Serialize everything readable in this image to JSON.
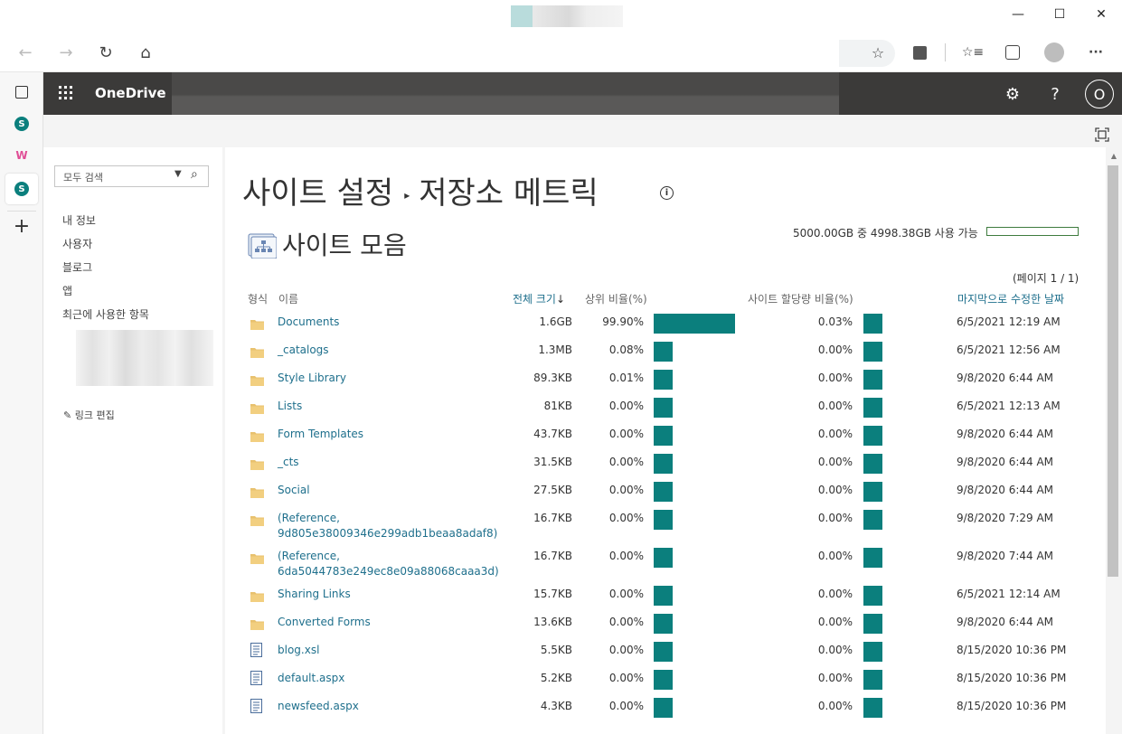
{
  "window": {
    "minimize": "—",
    "maximize": "☐",
    "close": "✕"
  },
  "toolbar": {
    "back": "←",
    "forward": "→",
    "refresh": "↻",
    "home": "⌂",
    "favorites": "☆",
    "menu": "···"
  },
  "suite": {
    "brand": "OneDrive",
    "avatar": "O"
  },
  "nav": {
    "search_placeholder": "모두 검색",
    "items": [
      "내 정보",
      "사용자",
      "블로그",
      "앱",
      "최근에 사용한 항목"
    ],
    "edit_links": "링크 편집"
  },
  "page": {
    "crumb1": "사이트 설정",
    "crumb2": "저장소 메트릭",
    "collection_title": "사이트 모음",
    "quota_text": "5000.00GB 중 4998.38GB 사용 가능",
    "page_info": "(페이지 1 / 1)"
  },
  "table": {
    "headers": {
      "type": "형식",
      "name": "이름",
      "total_size": "전체 크기",
      "parent_pct": "상위 비율(%)",
      "quota_pct": "사이트 할당량 비율(%)",
      "modified": "마지막으로 수정한 날짜"
    },
    "rows": [
      {
        "type": "folder",
        "name1": "Documents",
        "name2": "",
        "size": "1.6GB",
        "pct1": "99.90%",
        "fill1": 0.999,
        "pct2": "0.03%",
        "date": "6/5/2021 12:19 AM"
      },
      {
        "type": "folder",
        "name1": "_catalogs",
        "name2": "",
        "size": "1.3MB",
        "pct1": "0.08%",
        "fill1": 0,
        "pct2": "0.00%",
        "date": "6/5/2021 12:56 AM"
      },
      {
        "type": "folder",
        "name1": "Style Library",
        "name2": "",
        "size": "89.3KB",
        "pct1": "0.01%",
        "fill1": 0,
        "pct2": "0.00%",
        "date": "9/8/2020 6:44 AM"
      },
      {
        "type": "folder",
        "name1": "Lists",
        "name2": "",
        "size": "81KB",
        "pct1": "0.00%",
        "fill1": 0,
        "pct2": "0.00%",
        "date": "6/5/2021 12:13 AM"
      },
      {
        "type": "folder",
        "name1": "Form Templates",
        "name2": "",
        "size": "43.7KB",
        "pct1": "0.00%",
        "fill1": 0,
        "pct2": "0.00%",
        "date": "9/8/2020 6:44 AM"
      },
      {
        "type": "folder",
        "name1": "_cts",
        "name2": "",
        "size": "31.5KB",
        "pct1": "0.00%",
        "fill1": 0,
        "pct2": "0.00%",
        "date": "9/8/2020 6:44 AM"
      },
      {
        "type": "folder",
        "name1": "Social",
        "name2": "",
        "size": "27.5KB",
        "pct1": "0.00%",
        "fill1": 0,
        "pct2": "0.00%",
        "date": "9/8/2020 6:44 AM"
      },
      {
        "type": "folder",
        "name1": "(Reference,",
        "name2": "9d805e38009346e299adb1beaa8adaf8)",
        "size": "16.7KB",
        "pct1": "0.00%",
        "fill1": 0,
        "pct2": "0.00%",
        "date": "9/8/2020 7:29 AM"
      },
      {
        "type": "folder",
        "name1": "(Reference,",
        "name2": "6da5044783e249ec8e09a88068caaa3d)",
        "size": "16.7KB",
        "pct1": "0.00%",
        "fill1": 0,
        "pct2": "0.00%",
        "date": "9/8/2020 7:44 AM"
      },
      {
        "type": "folder",
        "name1": "Sharing Links",
        "name2": "",
        "size": "15.7KB",
        "pct1": "0.00%",
        "fill1": 0,
        "pct2": "0.00%",
        "date": "6/5/2021 12:14 AM"
      },
      {
        "type": "folder",
        "name1": "Converted Forms",
        "name2": "",
        "size": "13.6KB",
        "pct1": "0.00%",
        "fill1": 0,
        "pct2": "0.00%",
        "date": "9/8/2020 6:44 AM"
      },
      {
        "type": "file",
        "name1": "blog.xsl",
        "name2": "",
        "size": "5.5KB",
        "pct1": "0.00%",
        "fill1": 0,
        "pct2": "0.00%",
        "date": "8/15/2020 10:36 PM"
      },
      {
        "type": "file",
        "name1": "default.aspx",
        "name2": "",
        "size": "5.2KB",
        "pct1": "0.00%",
        "fill1": 0,
        "pct2": "0.00%",
        "date": "8/15/2020 10:36 PM"
      },
      {
        "type": "file",
        "name1": "newsfeed.aspx",
        "name2": "",
        "size": "4.3KB",
        "pct1": "0.00%",
        "fill1": 0,
        "pct2": "0.00%",
        "date": "8/15/2020 10:36 PM"
      }
    ]
  },
  "colors": {
    "teal": "#0b7f7d",
    "link": "#1e6f8c",
    "suite": "#3b3a39"
  }
}
